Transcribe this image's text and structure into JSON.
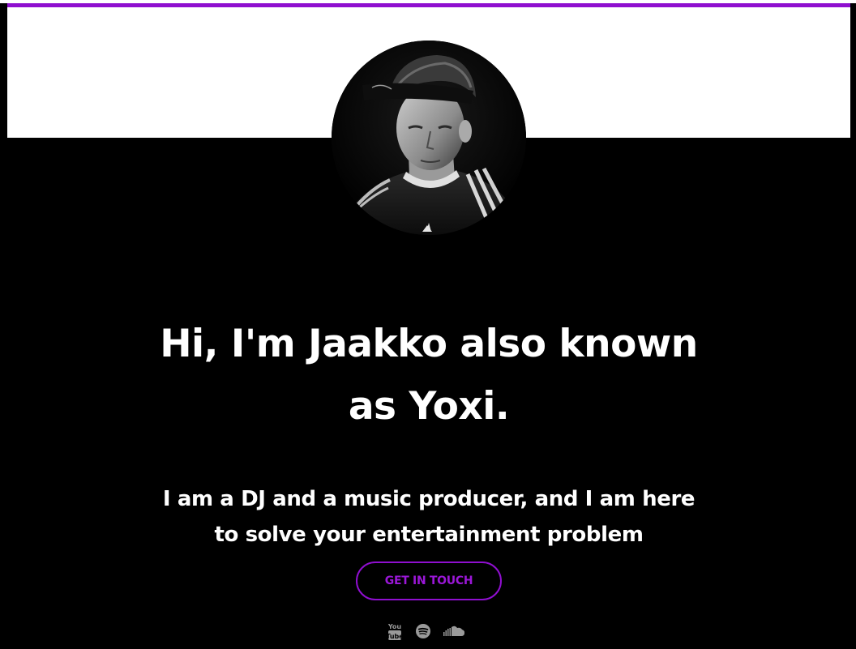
{
  "hero": {
    "headline_line1": "Hi, I'm Jaakko also known",
    "headline_line2": "as Yoxi.",
    "subline_line1": "I am a DJ and a music producer, and I am here",
    "subline_line2": "to solve your entertainment problem",
    "cta_label": "GET IN TOUCH"
  },
  "socials": [
    {
      "icon": "youtube-icon"
    },
    {
      "icon": "spotify-icon"
    },
    {
      "icon": "soundcloud-icon"
    }
  ],
  "colors": {
    "accent": "#8f0fcf",
    "background": "#000000",
    "text": "#ffffff",
    "icon": "#9a9a9a"
  }
}
